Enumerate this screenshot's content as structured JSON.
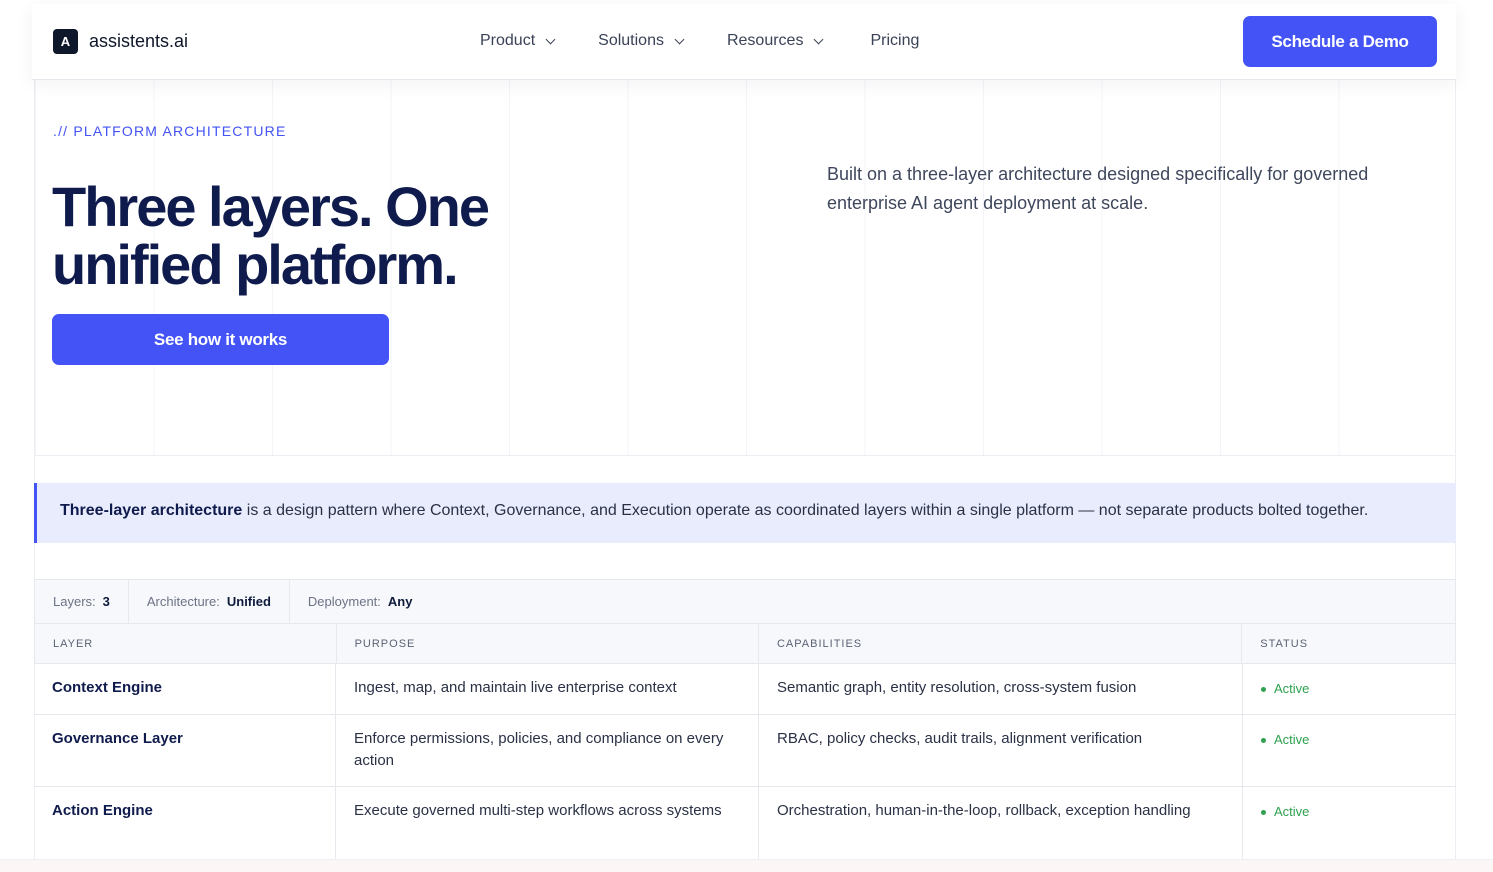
{
  "nav": {
    "brand_letter": "A",
    "brand_name": "assistents.ai",
    "menu": [
      {
        "label": "Product"
      },
      {
        "label": "Solutions"
      },
      {
        "label": "Resources"
      },
      {
        "label": "Pricing"
      }
    ],
    "cta": "Schedule a Demo"
  },
  "hero": {
    "eyebrow": ".// PLATFORM ARCHITECTURE",
    "title": "Three layers. One unified platform.",
    "button": "See how it works",
    "description": "Built on a three-layer architecture designed specifically for governed enterprise AI agent deployment at scale."
  },
  "definition": {
    "term": "Three-layer architecture",
    "text": " is a design pattern where Context, Governance, and Execution operate as coordinated layers within a single platform — not separate products bolted together."
  },
  "table": {
    "meta": [
      {
        "key": "Layers:",
        "value": "3"
      },
      {
        "key": "Architecture:",
        "value": "Unified"
      },
      {
        "key": "Deployment:",
        "value": "Any"
      }
    ],
    "headers": [
      "LAYER",
      "PURPOSE",
      "CAPABILITIES",
      "STATUS"
    ],
    "rows": [
      {
        "layer": "Context Engine",
        "purpose": "Ingest, map, and maintain live enterprise context",
        "capabilities": "Semantic graph, entity resolution, cross-system fusion",
        "status": "Active"
      },
      {
        "layer": "Governance Layer",
        "purpose": "Enforce permissions, policies, and compliance on every action",
        "capabilities": "RBAC, policy checks, audit trails, alignment verification",
        "status": "Active"
      },
      {
        "layer": "Action Engine",
        "purpose": "Execute governed multi-step workflows across systems",
        "capabilities": "Orchestration, human-in-the-loop, rollback, exception handling",
        "status": "Active"
      }
    ]
  },
  "colors": {
    "accent": "#4353f5",
    "heading": "#0f1b4d",
    "status_active": "#2ea24e"
  }
}
